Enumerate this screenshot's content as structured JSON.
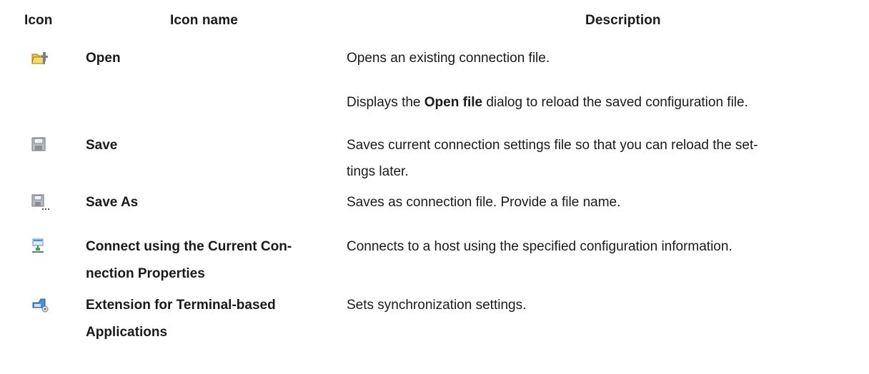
{
  "header": {
    "icon": "Icon",
    "name": "Icon name",
    "description": "Description"
  },
  "rows": [
    {
      "icon": "open-folder-icon",
      "name": "Open",
      "description": "Opens an existing connection file.",
      "description2_prefix": "Displays the ",
      "description2_bold": "Open file",
      "description2_suffix": " dialog to reload the saved configuration file."
    },
    {
      "icon": "save-disk-icon",
      "name": "Save",
      "description_line1": "Saves current connection settings file so that you can reload the set-",
      "description_line2": "tings later."
    },
    {
      "icon": "save-as-disk-icon",
      "name": "Save As",
      "description": "Saves as connection file. Provide a file name."
    },
    {
      "icon": "connect-network-icon",
      "name_line1": "Connect using the Current Con-",
      "name_line2": "nection Properties",
      "description": "Connects to a host using the specified configuration information."
    },
    {
      "icon": "terminal-extension-icon",
      "name_line1": "Extension for Terminal-based",
      "name_line2": "Applications",
      "description": "Sets synchronization settings."
    }
  ],
  "colors": {
    "text": "#1a1a1a",
    "folder": "#e8c53a",
    "disk": "#8a8f96",
    "network": "#4c8fd6",
    "green": "#3aa845"
  }
}
